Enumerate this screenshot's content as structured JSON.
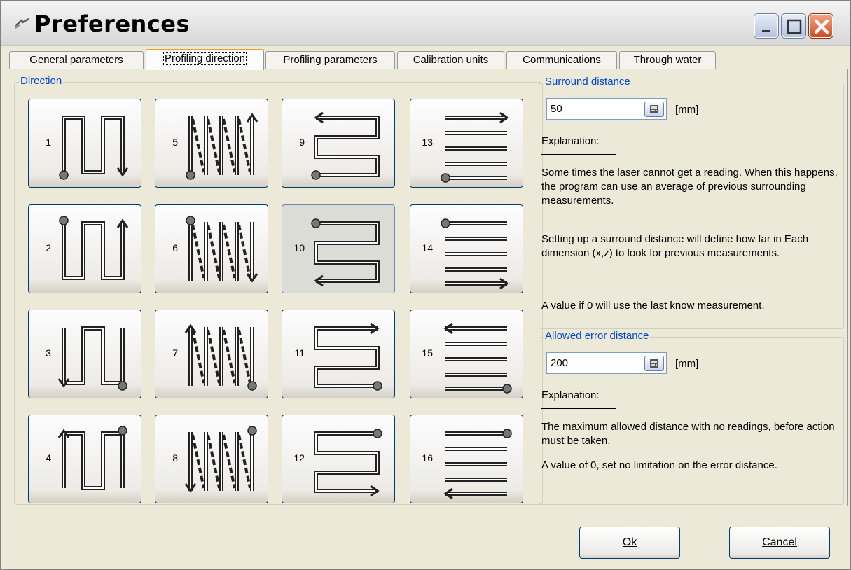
{
  "window": {
    "title": "Preferences"
  },
  "tabs": [
    {
      "label": "General parameters",
      "active": false
    },
    {
      "label": "Profiling direction",
      "active": true
    },
    {
      "label": "Profiling parameters",
      "active": false
    },
    {
      "label": "Calibration units",
      "active": false
    },
    {
      "label": "Communications",
      "active": false
    },
    {
      "label": "Through water",
      "active": false
    }
  ],
  "direction_group": {
    "label": "Direction",
    "buttons": [
      "1",
      "2",
      "3",
      "4",
      "5",
      "6",
      "7",
      "8",
      "9",
      "10",
      "11",
      "12",
      "13",
      "14",
      "15",
      "16"
    ],
    "selected": "10"
  },
  "surround": {
    "label": "Surround distance",
    "value": "50",
    "unit": "[mm]",
    "explanation_label": "Explanation:",
    "explanation": [
      "Some times the laser cannot get a reading. When this happens, the program can use an average of previous surrounding measurements.",
      "Setting up a surround distance will define how far in Each dimension (x,z) to look for previous measurements.",
      "A value if 0 will use the last know measurement."
    ]
  },
  "error": {
    "label": "Allowed error distance",
    "value": "200",
    "unit": "[mm]",
    "explanation_label": "Explanation:",
    "explanation": [
      "The maximum allowed distance with no readings, before action must be taken.",
      "A value of 0, set no limitation on the error distance."
    ]
  },
  "footer": {
    "ok_label": "Ok",
    "cancel_label": "Cancel"
  }
}
